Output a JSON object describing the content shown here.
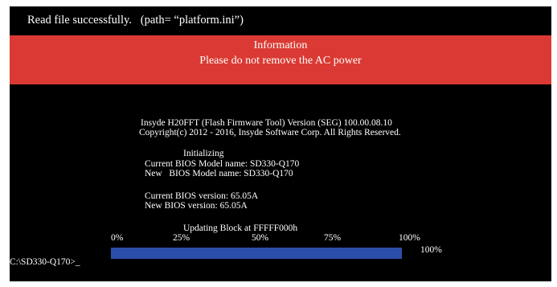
{
  "status": "Read file successfully.   (path= “platform.ini”)",
  "info": {
    "title": "Information",
    "message": "Please do not remove the AC power"
  },
  "tool": {
    "version_line": "Insyde H20FFT (Flash Firmware Tool) Version (SEG) 100.00.08.10",
    "copyright": "Copyright(c) 2012 - 2016, Insyde Software Corp. All Rights Reserved."
  },
  "state": "Initializing",
  "bios": {
    "current_model": "Current BIOS Model name: SD330-Q170",
    "new_model": "New   BIOS Model name: SD330-Q170",
    "current_version": "Current BIOS version: 65.05A",
    "new_version": "New BIOS version: 65.05A"
  },
  "update": {
    "block_label": "Updating Block at FFFFF000h",
    "scale": [
      "0%",
      "25%",
      "50%",
      "75%",
      "100%"
    ],
    "percent_text": "100%",
    "progress": 1.0
  },
  "prompt": "C:\\SD330-Q170>",
  "cursor": "_",
  "colors": {
    "screen_bg": "#000000",
    "banner": "#da3a33",
    "progress_fill": "#2b4fa8",
    "text": "#ffffff"
  }
}
